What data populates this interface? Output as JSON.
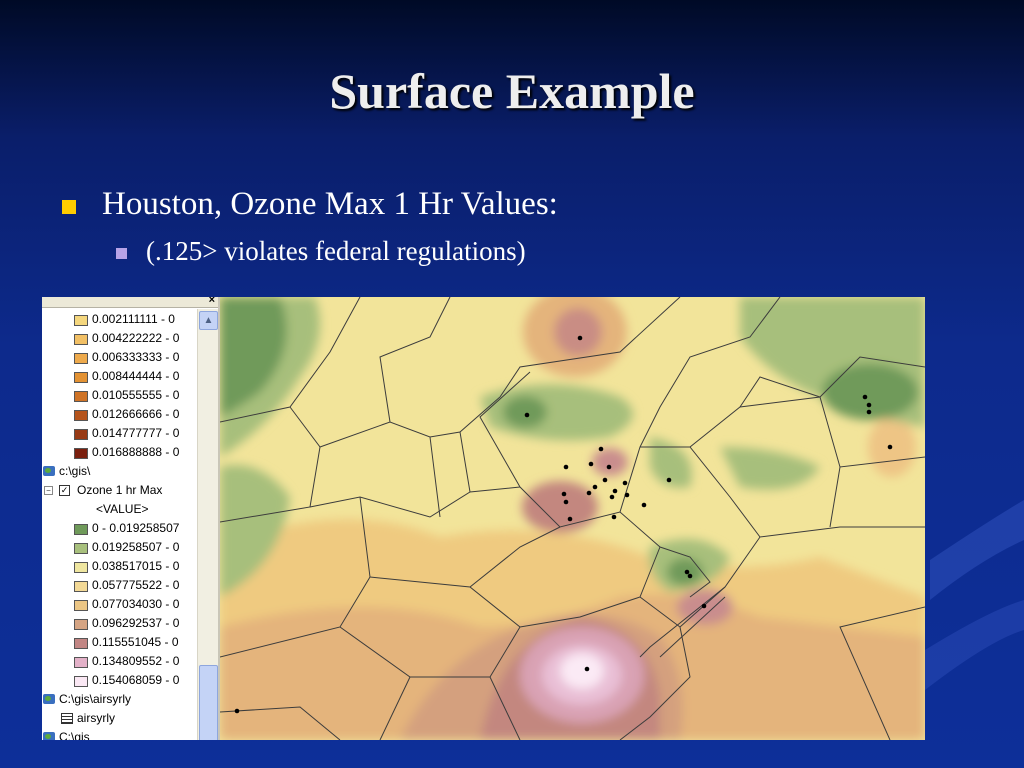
{
  "slide": {
    "title": "Surface Example",
    "bullet": "Houston, Ozone Max 1 Hr Values:",
    "sub_bullet": "(.125> violates federal regulations)"
  },
  "toc": {
    "close_glyph": "×",
    "upper_ranges": [
      {
        "label": "0.002111111 - 0",
        "color": "#f5d77e"
      },
      {
        "label": "0.004222222 - 0",
        "color": "#f2c065"
      },
      {
        "label": "0.006333333 - 0",
        "color": "#eeaa4c"
      },
      {
        "label": "0.008444444 - 0",
        "color": "#e39233"
      },
      {
        "label": "0.010555555 - 0",
        "color": "#cf7326"
      },
      {
        "label": "0.012666666 - 0",
        "color": "#b5541c"
      },
      {
        "label": "0.014777777 - 0",
        "color": "#983a15"
      },
      {
        "label": "0.016888888 - 0",
        "color": "#7a1f0e"
      }
    ],
    "folder_gis": "c:\\gis\\",
    "layer_name": "Ozone 1 hr Max",
    "value_field": "<VALUE>",
    "ozone_ranges": [
      {
        "label": "0 - 0.019258507",
        "color": "#6f9a5a"
      },
      {
        "label": "0.019258507 - 0",
        "color": "#a8c07d"
      },
      {
        "label": "0.038517015 - 0",
        "color": "#efe6a0"
      },
      {
        "label": "0.057775522 - 0",
        "color": "#f3d996"
      },
      {
        "label": "0.077034030 - 0",
        "color": "#ecc685"
      },
      {
        "label": "0.096292537 - 0",
        "color": "#d5a483"
      },
      {
        "label": "0.115551045 - 0",
        "color": "#c28684"
      },
      {
        "label": "0.134809552 - 0",
        "color": "#e3b1c8"
      },
      {
        "label": "0.154068059 - 0",
        "color": "#fae8f4"
      }
    ],
    "folder_airsyrly": "C:\\gis\\airsyrly",
    "table_name": "airsyrly",
    "folder_c_gis": "C:\\gis"
  },
  "map": {
    "legend_meaning": "ozone max 1 hr surface"
  }
}
